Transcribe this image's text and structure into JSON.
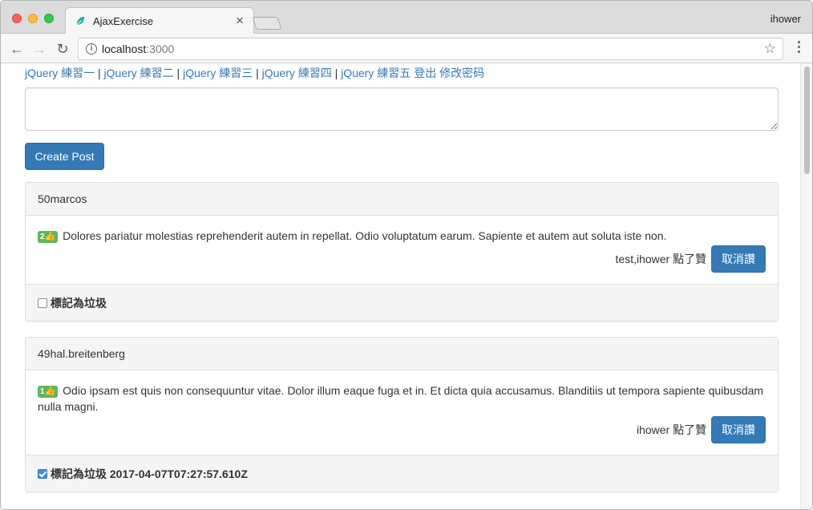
{
  "browser": {
    "tab_title": "AjaxExercise",
    "tab_close": "×",
    "profile_name": "ihower",
    "url_host": "localhost",
    "url_port": ":3000",
    "info_glyph": "i",
    "star_glyph": "☆",
    "back_glyph": "←",
    "forward_glyph": "→",
    "reload_glyph": "↻"
  },
  "nav": {
    "links": [
      "jQuery 練習一",
      "jQuery 練習二",
      "jQuery 練習三",
      "jQuery 練習四",
      "jQuery 練習五"
    ],
    "separator": " | ",
    "logout": "登出",
    "change_password": "修改密码"
  },
  "composer": {
    "textarea_value": "",
    "create_label": "Create Post"
  },
  "posts": [
    {
      "author": "50marcos",
      "like_count": "2",
      "like_icon": "👍",
      "text": "Dolores pariatur molestias reprehenderit autem in repellat. Odio voluptatum earum. Sapiente et autem aut soluta iste non.",
      "likers": "test,ihower 點了贊",
      "unlike_label": "取消讚",
      "spam_label": "標記為垃圾",
      "spam_checked": false,
      "spam_timestamp": ""
    },
    {
      "author": "49hal.breitenberg",
      "like_count": "1",
      "like_icon": "👍",
      "text": "Odio ipsam est quis non consequuntur vitae. Dolor illum eaque fuga et in. Et dicta quia accusamus. Blanditiis ut tempora sapiente quibusdam nulla magni.",
      "likers": "ihower 點了贊",
      "unlike_label": "取消讚",
      "spam_label": "標記為垃圾",
      "spam_checked": true,
      "spam_timestamp": "2017-04-07T07:27:57.610Z"
    }
  ],
  "colors": {
    "link": "#337ab7",
    "primary_button": "#337ab7",
    "badge": "#5cb85c",
    "checkbox_checked": "#3d8ee8"
  }
}
